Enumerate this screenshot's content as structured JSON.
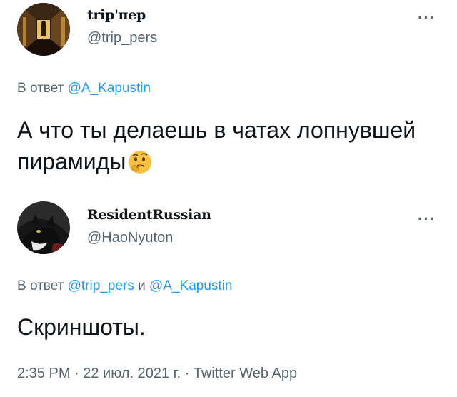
{
  "tweets": [
    {
      "display_name": "trip'пер",
      "handle": "@trip_pers",
      "more": "···",
      "reply_prefix": "В ответ",
      "reply_handles": [
        "@A_Kapustin"
      ],
      "text": "А что ты делаешь в чатах лопнувшей пирамиды",
      "emoji_icon": "thinking-face-icon"
    },
    {
      "display_name": "ResidentRussian",
      "handle": "@HaoNyuton",
      "more": "···",
      "reply_prefix": "В ответ",
      "reply_handles": [
        "@trip_pers",
        "@A_Kapustin"
      ],
      "reply_conjunction": "и",
      "text": "Скриншоты.",
      "meta": "2:35 PM · 22 июл. 2021 г. · Twitter Web App"
    }
  ],
  "colors": {
    "link": "#1d9bf0",
    "secondary": "#536471",
    "text": "#0f1419"
  }
}
